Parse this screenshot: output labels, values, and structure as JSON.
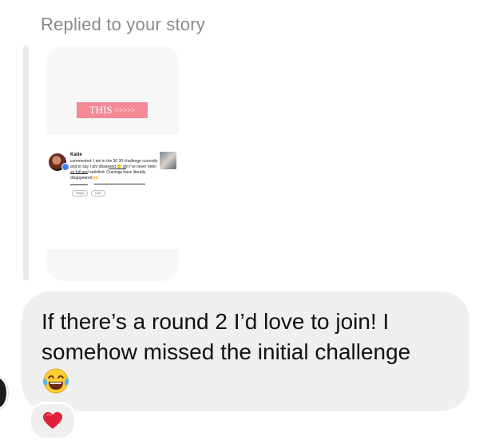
{
  "reply": {
    "header": "Replied to your story"
  },
  "story": {
    "banner_text": "THIS",
    "banner_arrows": ">>>>>",
    "comment": {
      "author": "Katie",
      "text": "commented: I am in the 30 30 challenge currently and to say I am obsessed 🙂 girl I've never been so full and satisfied. Cravings have literally disappeared 🙌",
      "actions": [
        "Reply",
        "Like"
      ]
    }
  },
  "message": {
    "text": "If there’s a round 2 I’d love to join! I somehow missed the initial challenge",
    "emoji": "face-with-tears-of-joy-icon"
  },
  "reaction": {
    "icon": "red-heart-icon",
    "color": "#e0203a"
  },
  "colors": {
    "bubble": "#efeff0",
    "header_text": "#8a8a8e",
    "banner": "#f38a96"
  }
}
